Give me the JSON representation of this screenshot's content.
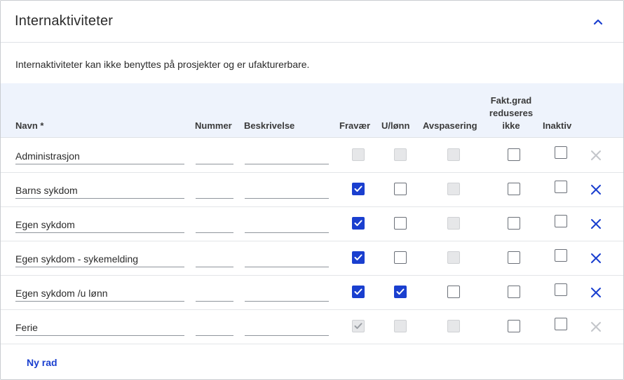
{
  "panel": {
    "title": "Internaktiviteter",
    "collapse_icon": "chevron-up-icon",
    "intro": "Internaktiviteter kan ikke benyttes på prosjekter og er ufakturerbare."
  },
  "columns": {
    "navn": "Navn *",
    "nummer": "Nummer",
    "beskrivelse": "Beskrivelse",
    "fravaer": "Fravær",
    "ulonn": "U/lønn",
    "avspasering": "Avspasering",
    "faktgrad": [
      "Fakt.grad",
      "reduseres",
      "ikke"
    ],
    "inaktiv": "Inaktiv"
  },
  "rows": [
    {
      "navn": "Administrasjon",
      "nummer": "",
      "beskrivelse": "",
      "fravaer": {
        "checked": false,
        "disabled": true
      },
      "ulonn": {
        "checked": false,
        "disabled": true
      },
      "avspasering": {
        "checked": false,
        "disabled": true
      },
      "faktgrad": {
        "checked": false,
        "disabled": false
      },
      "inaktiv": {
        "checked": false,
        "disabled": false
      },
      "deletable": false
    },
    {
      "navn": "Barns sykdom",
      "nummer": "",
      "beskrivelse": "",
      "fravaer": {
        "checked": true,
        "disabled": false
      },
      "ulonn": {
        "checked": false,
        "disabled": false
      },
      "avspasering": {
        "checked": false,
        "disabled": true
      },
      "faktgrad": {
        "checked": false,
        "disabled": false
      },
      "inaktiv": {
        "checked": false,
        "disabled": false
      },
      "deletable": true
    },
    {
      "navn": "Egen sykdom",
      "nummer": "",
      "beskrivelse": "",
      "fravaer": {
        "checked": true,
        "disabled": false
      },
      "ulonn": {
        "checked": false,
        "disabled": false
      },
      "avspasering": {
        "checked": false,
        "disabled": true
      },
      "faktgrad": {
        "checked": false,
        "disabled": false
      },
      "inaktiv": {
        "checked": false,
        "disabled": false
      },
      "deletable": true
    },
    {
      "navn": "Egen sykdom - sykemelding",
      "nummer": "",
      "beskrivelse": "",
      "fravaer": {
        "checked": true,
        "disabled": false
      },
      "ulonn": {
        "checked": false,
        "disabled": false
      },
      "avspasering": {
        "checked": false,
        "disabled": true
      },
      "faktgrad": {
        "checked": false,
        "disabled": false
      },
      "inaktiv": {
        "checked": false,
        "disabled": false
      },
      "deletable": true
    },
    {
      "navn": "Egen sykdom /u lønn",
      "nummer": "",
      "beskrivelse": "",
      "fravaer": {
        "checked": true,
        "disabled": false
      },
      "ulonn": {
        "checked": true,
        "disabled": false
      },
      "avspasering": {
        "checked": false,
        "disabled": false
      },
      "faktgrad": {
        "checked": false,
        "disabled": false
      },
      "inaktiv": {
        "checked": false,
        "disabled": false
      },
      "deletable": true
    },
    {
      "navn": "Ferie",
      "nummer": "",
      "beskrivelse": "",
      "fravaer": {
        "checked": true,
        "disabled": true
      },
      "ulonn": {
        "checked": false,
        "disabled": true
      },
      "avspasering": {
        "checked": false,
        "disabled": true
      },
      "faktgrad": {
        "checked": false,
        "disabled": false
      },
      "inaktiv": {
        "checked": false,
        "disabled": false
      },
      "deletable": false
    }
  ],
  "actions": {
    "new_row_label": "Ny rad",
    "delete_icon": "close-icon"
  },
  "colors": {
    "accent": "#1a3fcf",
    "header_bg": "#eef3fc",
    "disabled_icon": "#c3c6ca"
  }
}
